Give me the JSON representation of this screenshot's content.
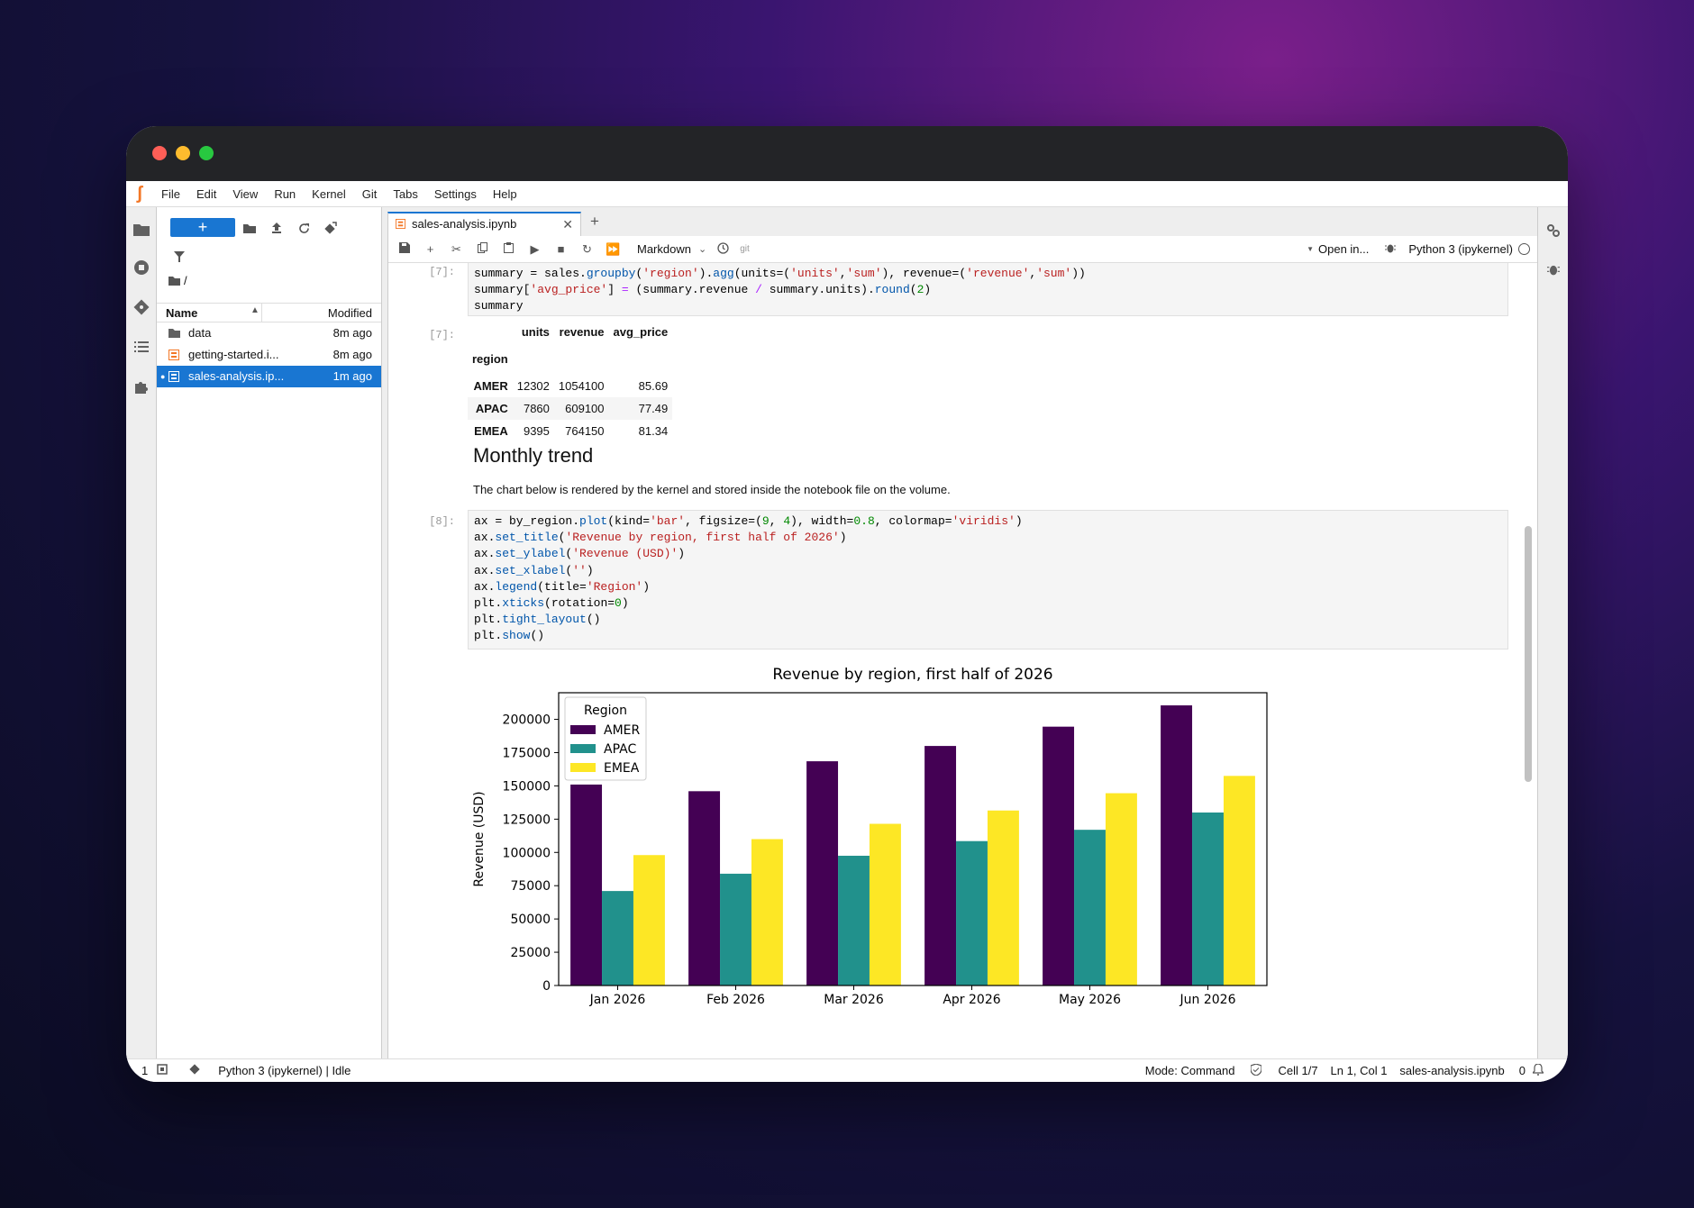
{
  "menu": {
    "items": [
      "File",
      "Edit",
      "View",
      "Run",
      "Kernel",
      "Git",
      "Tabs",
      "Settings",
      "Help"
    ]
  },
  "filebrowser": {
    "path": "/",
    "col_name": "Name",
    "col_modified": "Modified",
    "files": [
      {
        "name": "data",
        "modified": "8m ago",
        "icon": "folder-icon"
      },
      {
        "name": "getting-started.i...",
        "modified": "8m ago",
        "icon": "notebook-icon"
      },
      {
        "name": "sales-analysis.ip...",
        "modified": "1m ago",
        "icon": "notebook-icon"
      }
    ]
  },
  "tab": {
    "title": "sales-analysis.ipynb"
  },
  "toolbar": {
    "cell_type": "Markdown",
    "git": "git",
    "open_in": "Open in...",
    "kernel": "Python 3 (ipykernel)"
  },
  "cells": {
    "c7_prompt": "[7]:",
    "c7_out_prompt": "[7]:",
    "c8_prompt": "[8]:",
    "heading": "Monthly trend",
    "paragraph": "The chart below is rendered by the kernel and stored inside the notebook file on the volume."
  },
  "dataframe": {
    "columns": [
      "units",
      "revenue",
      "avg_price"
    ],
    "index_name": "region",
    "rows": [
      {
        "region": "AMER",
        "units": "12302",
        "revenue": "1054100",
        "avg_price": "85.69"
      },
      {
        "region": "APAC",
        "units": "7860",
        "revenue": "609100",
        "avg_price": "77.49"
      },
      {
        "region": "EMEA",
        "units": "9395",
        "revenue": "764150",
        "avg_price": "81.34"
      }
    ]
  },
  "chart_data": {
    "type": "bar",
    "title": "Revenue by region, first half of 2026",
    "xlabel": "",
    "ylabel": "Revenue (USD)",
    "ylim": [
      0,
      220000
    ],
    "yticks": [
      0,
      25000,
      50000,
      75000,
      100000,
      125000,
      150000,
      175000,
      200000
    ],
    "categories": [
      "Jan 2026",
      "Feb 2026",
      "Mar 2026",
      "Apr 2026",
      "May 2026",
      "Jun 2026"
    ],
    "legend_title": "Region",
    "legend_position": "top-left",
    "series": [
      {
        "name": "AMER",
        "color": "#440154",
        "values": [
          151000,
          146000,
          168500,
          180000,
          194500,
          210500
        ]
      },
      {
        "name": "APAC",
        "color": "#21918c",
        "values": [
          71000,
          84000,
          97500,
          108500,
          117000,
          130000
        ]
      },
      {
        "name": "EMEA",
        "color": "#fde725",
        "values": [
          98000,
          110000,
          121500,
          131500,
          144500,
          157500
        ]
      }
    ]
  },
  "status": {
    "count": "1",
    "kernel": "Python 3 (ipykernel) | Idle",
    "mode": "Mode: Command",
    "cell": "Cell 1/7",
    "position": "Ln 1, Col 1",
    "file": "sales-analysis.ipynb",
    "notifications": "0"
  }
}
